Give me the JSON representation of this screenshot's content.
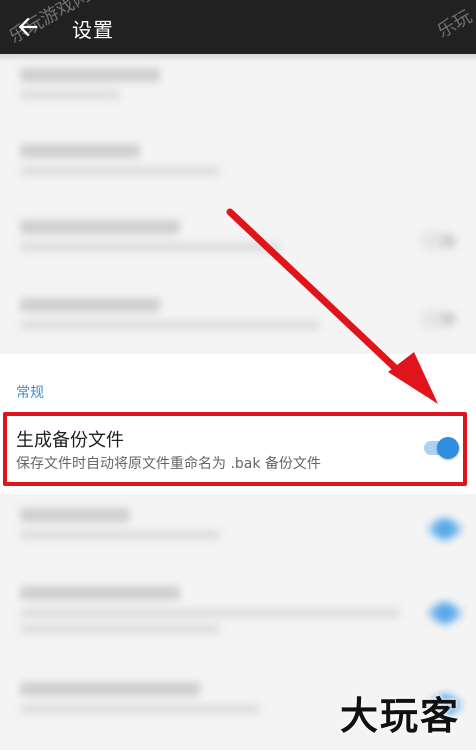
{
  "header": {
    "title": "设置"
  },
  "section": {
    "label": "常规"
  },
  "backup_item": {
    "title": "生成备份文件",
    "subtitle": "保存文件时自动将原文件重命名为 .bak 备份文件",
    "toggle_on": true
  },
  "watermarks": {
    "corner_left": "乐玩游戏网",
    "corner_right": "乐玩",
    "logo": "大玩客"
  },
  "colors": {
    "accent": "#2f8ee0",
    "highlight": "#e0151b",
    "topbar": "#212121"
  }
}
